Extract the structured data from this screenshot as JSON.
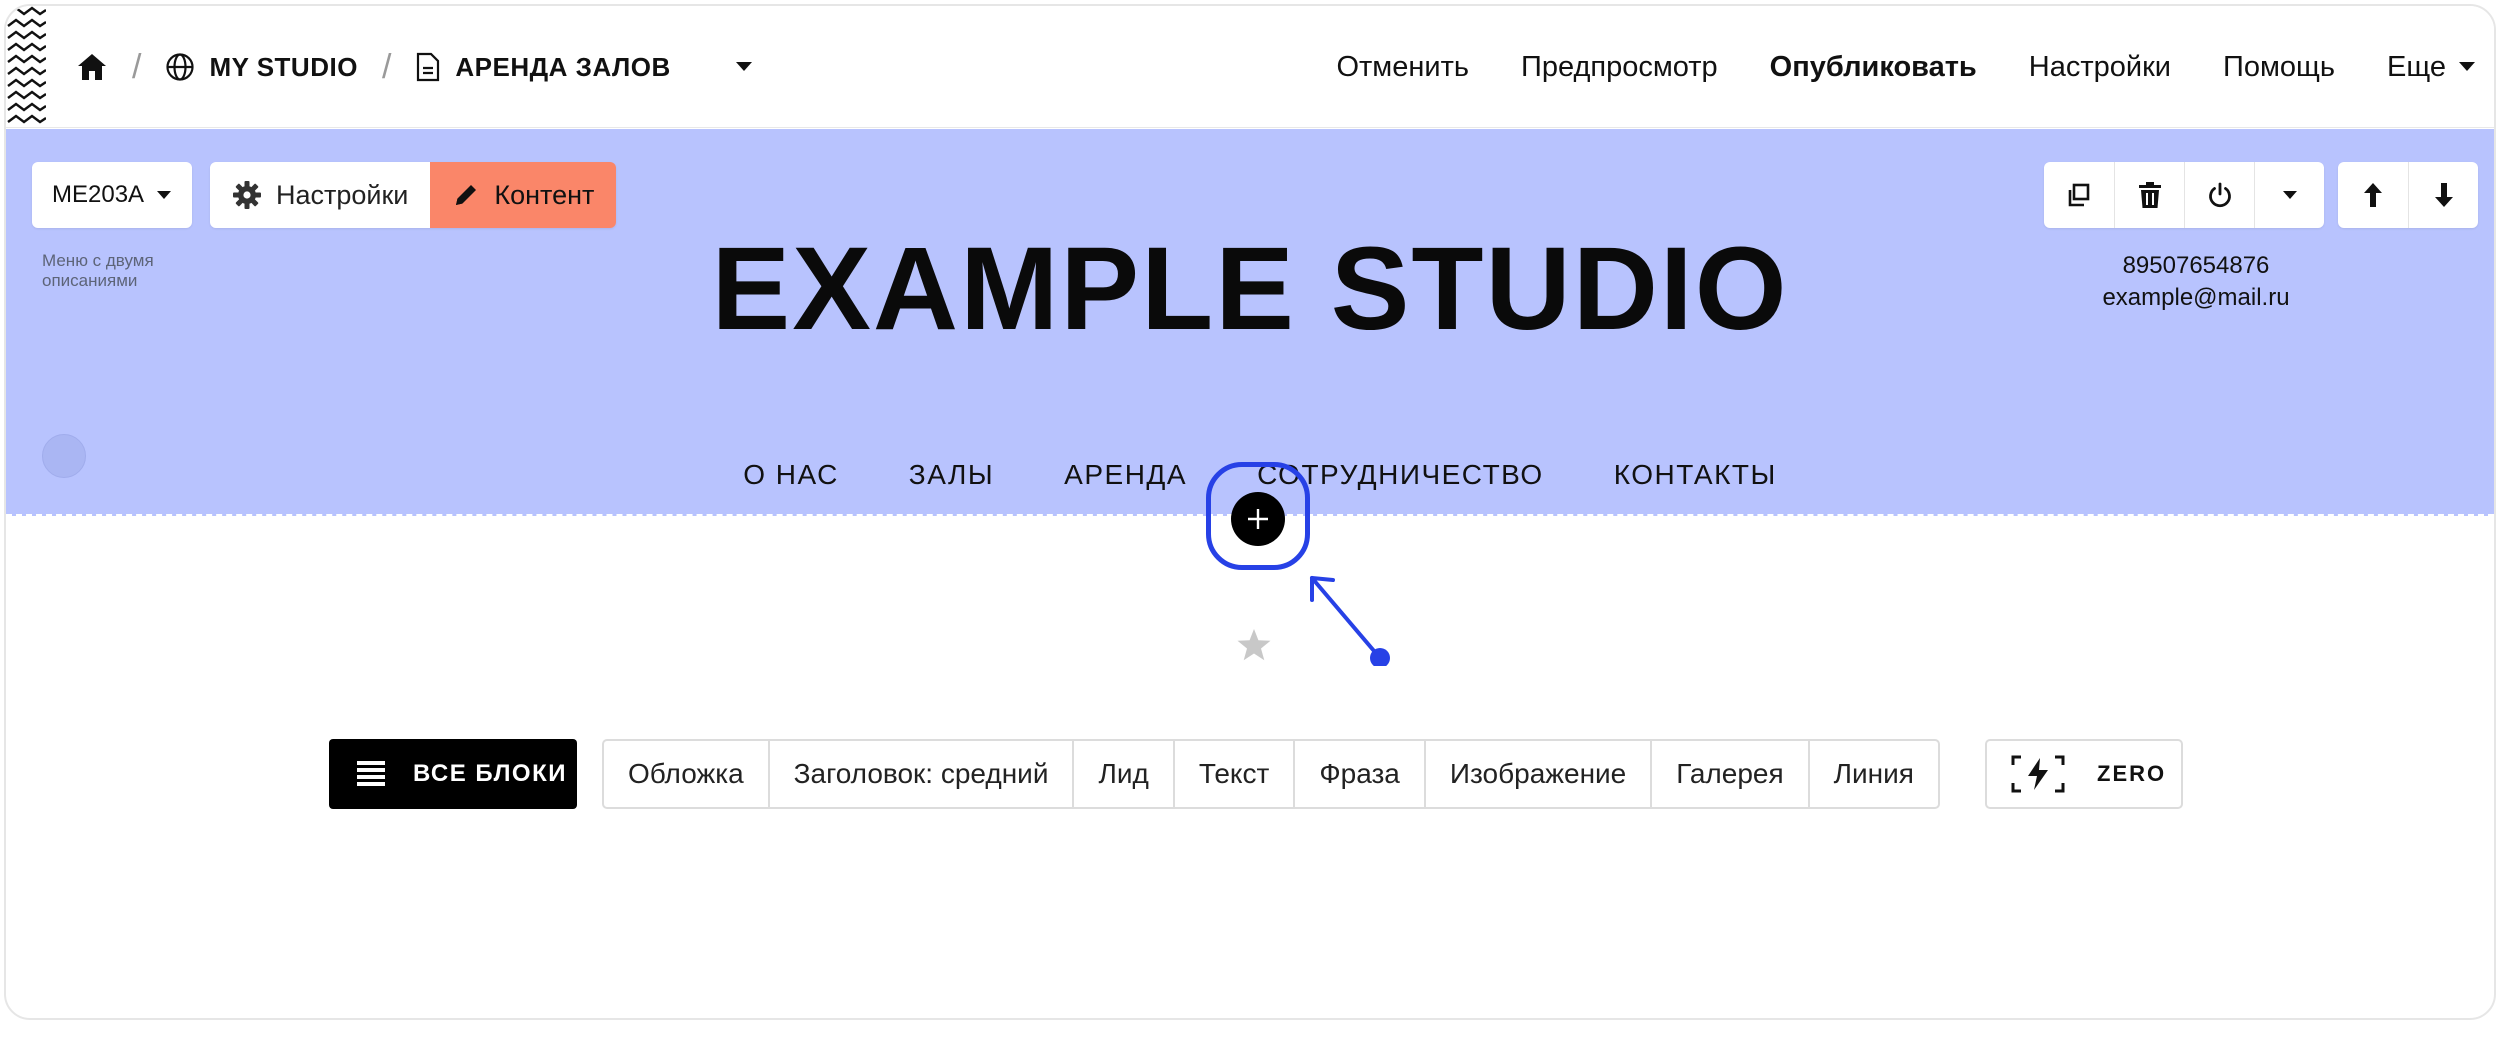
{
  "breadcrumb": {
    "home_icon": "home-icon",
    "site_label": "MY STUDIO",
    "site_icon": "globe-icon",
    "page_label": "АРЕНДА ЗАЛОВ",
    "page_icon": "document-icon",
    "separator": "/"
  },
  "topnav": {
    "undo": "Отменить",
    "preview": "Предпросмотр",
    "publish": "Опубликовать",
    "settings": "Настройки",
    "help": "Помощь",
    "more": "Еще"
  },
  "block": {
    "code": "ME203A",
    "settings_label": "Настройки",
    "content_label": "Контент",
    "description": "Меню с двумя описаниями",
    "background_color": "#b8c3fe",
    "accent_color": "#fa8669"
  },
  "site_header": {
    "title": "EXAMPLE STUDIO",
    "phone": "89507654876",
    "email": "example@mail.ru",
    "menu": [
      "О НАС",
      "ЗАЛЫ",
      "АРЕНДА",
      "СОТРУДНИЧЕСТВО",
      "КОНТАКТЫ"
    ]
  },
  "palette": {
    "all_blocks_label": "ВСЕ БЛОКИ",
    "types": [
      "Обложка",
      "Заголовок: средний",
      "Лид",
      "Текст",
      "Фраза",
      "Изображение",
      "Галерея",
      "Линия"
    ],
    "zero_label": "ZERO"
  },
  "annotation_color": "#2741e6"
}
